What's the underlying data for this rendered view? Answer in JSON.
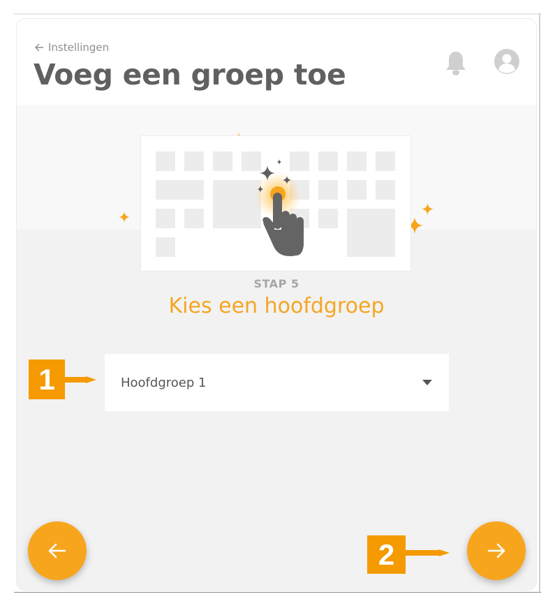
{
  "header": {
    "back_label": "Instellingen",
    "title": "Voeg een groep toe",
    "bell_icon": "bell-icon",
    "avatar_icon": "user-avatar-icon"
  },
  "wizard": {
    "step_label": "STAP 5",
    "step_title": "Kies een hoofdgroep"
  },
  "select": {
    "value": "Hoofdgroep 1",
    "caret_icon": "caret-down-icon"
  },
  "nav": {
    "back_icon": "arrow-left-icon",
    "next_icon": "arrow-right-icon"
  },
  "annotations": {
    "marker_1": "1",
    "marker_2": "2"
  },
  "colors": {
    "accent": "#f7a51d",
    "annotation": "#f59a00",
    "title": "#606060",
    "page_bg": "#f2f2f2"
  }
}
